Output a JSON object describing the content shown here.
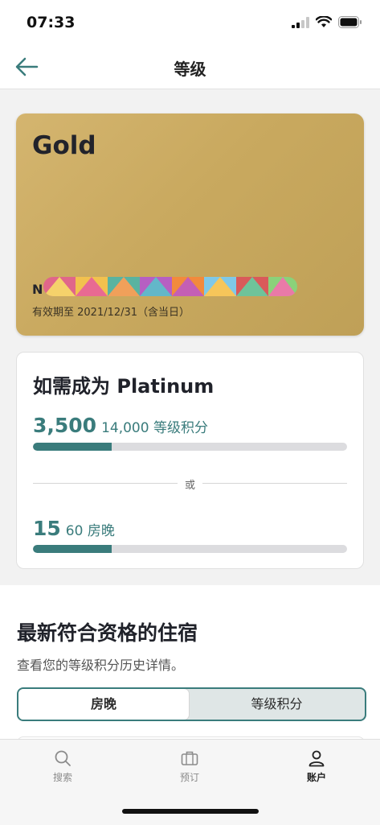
{
  "status_bar": {
    "time": "07:33"
  },
  "header": {
    "title": "等级"
  },
  "tier_card": {
    "tier": "Gold",
    "member_name_visible": "N",
    "validity": "有效期至 2021/12/31（含当日）"
  },
  "progress": {
    "title": "如需成为 Platinum",
    "points": {
      "current": "3,500",
      "target": "14,000 等级积分",
      "fraction": 0.25
    },
    "divider": "或",
    "nights": {
      "current": "15",
      "target": "60 房晚",
      "fraction": 0.25
    }
  },
  "stays": {
    "title": "最新符合资格的住宿",
    "subtitle": "查看您的等级积分历史详情。",
    "segments": {
      "nights": "房晚",
      "points": "等级积分"
    }
  },
  "tabs": [
    {
      "label": "搜索",
      "icon": "search-icon"
    },
    {
      "label": "预订",
      "icon": "suitcase-icon"
    },
    {
      "label": "账户",
      "icon": "person-icon"
    }
  ],
  "colors": {
    "accent": "#3a7c7c",
    "gold": "#c9a95f"
  }
}
